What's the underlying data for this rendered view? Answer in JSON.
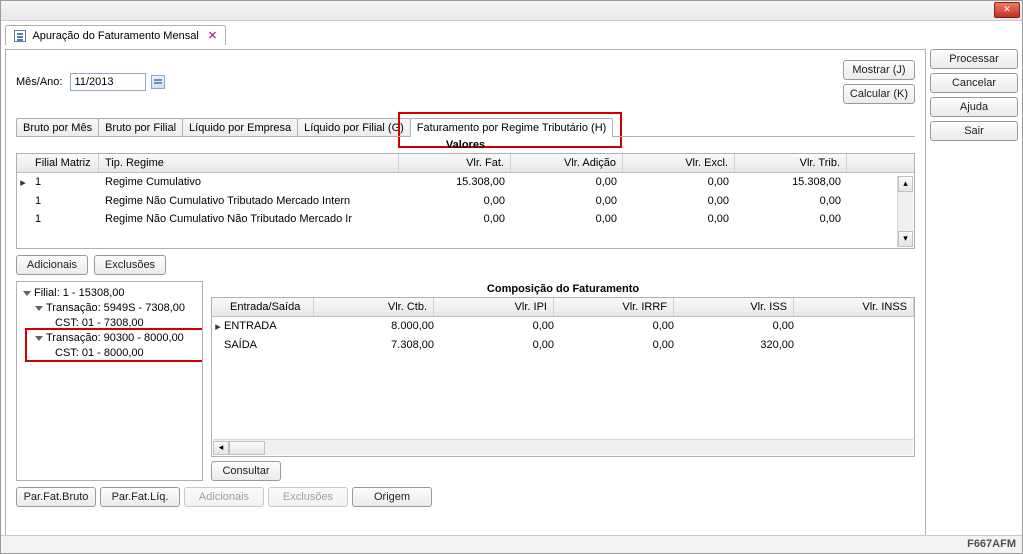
{
  "window": {
    "doc_tab_title": "Apuração do Faturamento Mensal",
    "status_code": "F667AFM"
  },
  "top": {
    "mes_ano_label": "Mês/Ano:",
    "mes_ano_value": "11/2013"
  },
  "top_buttons": {
    "mostrar": "Mostrar (J)",
    "calcular": "Calcular (K)"
  },
  "side_buttons": {
    "processar": "Processar",
    "cancelar": "Cancelar",
    "ajuda": "Ajuda",
    "sair": "Sair"
  },
  "inner_tabs": [
    "Bruto por Mês",
    "Bruto por Filial",
    "Líquido por Empresa",
    "Líquido por Filial (G)",
    "Faturamento por Regime Tributário (H)"
  ],
  "valores_label": "Valores",
  "grid1": {
    "headers": {
      "filial_matriz": "Filial Matriz",
      "tip_regime": "Tip. Regime",
      "vlr_fat": "Vlr. Fat.",
      "vlr_adicao": "Vlr. Adição",
      "vlr_excl": "Vlr. Excl.",
      "vlr_trib": "Vlr. Trib."
    },
    "rows": [
      {
        "filial": "1",
        "regime": "Regime Cumulativo",
        "fat": "15.308,00",
        "adicao": "0,00",
        "excl": "0,00",
        "trib": "15.308,00"
      },
      {
        "filial": "1",
        "regime": "Regime Não Cumulativo Tributado Mercado Intern",
        "fat": "0,00",
        "adicao": "0,00",
        "excl": "0,00",
        "trib": "0,00"
      },
      {
        "filial": "1",
        "regime": "Regime Não Cumulativo Não Tributado Mercado Ir",
        "fat": "0,00",
        "adicao": "0,00",
        "excl": "0,00",
        "trib": "0,00"
      }
    ]
  },
  "mid_buttons": {
    "adicionais": "Adicionais",
    "exclusoes": "Exclusões"
  },
  "tree": {
    "root": "Filial: 1 - 15308,00",
    "t1": "Transação: 5949S - 7308,00",
    "t1_cst": "CST: 01 - 7308,00",
    "t2": "Transação: 90300 - 8000,00",
    "t2_cst": "CST: 01 - 8000,00"
  },
  "comp": {
    "title": "Composição do Faturamento",
    "headers": {
      "es": "Entrada/Saída",
      "ctb": "Vlr. Ctb.",
      "ipi": "Vlr. IPI",
      "irrf": "Vlr. IRRF",
      "iss": "Vlr. ISS",
      "inss": "Vlr. INSS"
    },
    "rows": [
      {
        "es": "ENTRADA",
        "ctb": "8.000,00",
        "ipi": "0,00",
        "irrf": "0,00",
        "iss": "0,00",
        "inss": ""
      },
      {
        "es": "SAÍDA",
        "ctb": "7.308,00",
        "ipi": "0,00",
        "irrf": "0,00",
        "iss": "320,00",
        "inss": ""
      }
    ]
  },
  "consultar_btn": "Consultar",
  "bottom_buttons": {
    "par_bruto": "Par.Fat.Bruto",
    "par_liq": "Par.Fat.Líq.",
    "adicionais": "Adicionais",
    "exclusoes": "Exclusões",
    "origem": "Origem"
  }
}
